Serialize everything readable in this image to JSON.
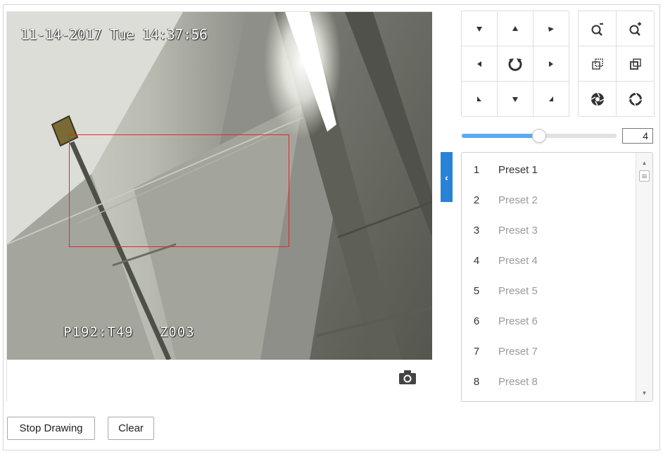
{
  "video": {
    "osd_datetime": "11-14-2017 Tue 14:37:56",
    "osd_ptz": "P192:T49   Z003",
    "snapshot_icon": "camera-icon"
  },
  "sidebar_toggle": {
    "icon": "chevron-left-icon",
    "label": "‹"
  },
  "ptz": {
    "directions": [
      {
        "name": "up-left",
        "icon": "arrow-up-left-icon"
      },
      {
        "name": "up",
        "icon": "arrow-up-icon"
      },
      {
        "name": "up-right",
        "icon": "arrow-up-right-icon"
      },
      {
        "name": "left",
        "icon": "arrow-left-icon"
      },
      {
        "name": "auto-pan",
        "icon": "auto-rotate-icon"
      },
      {
        "name": "right",
        "icon": "arrow-right-icon"
      },
      {
        "name": "down-left",
        "icon": "arrow-down-left-icon"
      },
      {
        "name": "down",
        "icon": "arrow-down-icon"
      },
      {
        "name": "down-right",
        "icon": "arrow-down-right-icon"
      }
    ],
    "lens": [
      {
        "name": "zoom-out",
        "icon": "zoom-out-icon"
      },
      {
        "name": "zoom-in",
        "icon": "zoom-in-icon"
      },
      {
        "name": "focus-near",
        "icon": "focus-near-icon"
      },
      {
        "name": "focus-far",
        "icon": "focus-far-icon"
      },
      {
        "name": "iris-close",
        "icon": "iris-close-icon"
      },
      {
        "name": "iris-open",
        "icon": "iris-open-icon"
      }
    ],
    "speed_fraction": 0.5,
    "speed_value": "4"
  },
  "presets": {
    "items": [
      {
        "num": "1",
        "label": "Preset 1"
      },
      {
        "num": "2",
        "label": "Preset 2"
      },
      {
        "num": "3",
        "label": "Preset 3"
      },
      {
        "num": "4",
        "label": "Preset 4"
      },
      {
        "num": "5",
        "label": "Preset 5"
      },
      {
        "num": "6",
        "label": "Preset 6"
      },
      {
        "num": "7",
        "label": "Preset 7"
      },
      {
        "num": "8",
        "label": "Preset 8"
      }
    ],
    "active_index": 0
  },
  "buttons": {
    "stop_drawing": "Stop Drawing",
    "clear": "Clear"
  },
  "colors": {
    "accent": "#2683d8",
    "slider_fill": "#5aaaf0",
    "draw_rect": "#e02a2a"
  }
}
